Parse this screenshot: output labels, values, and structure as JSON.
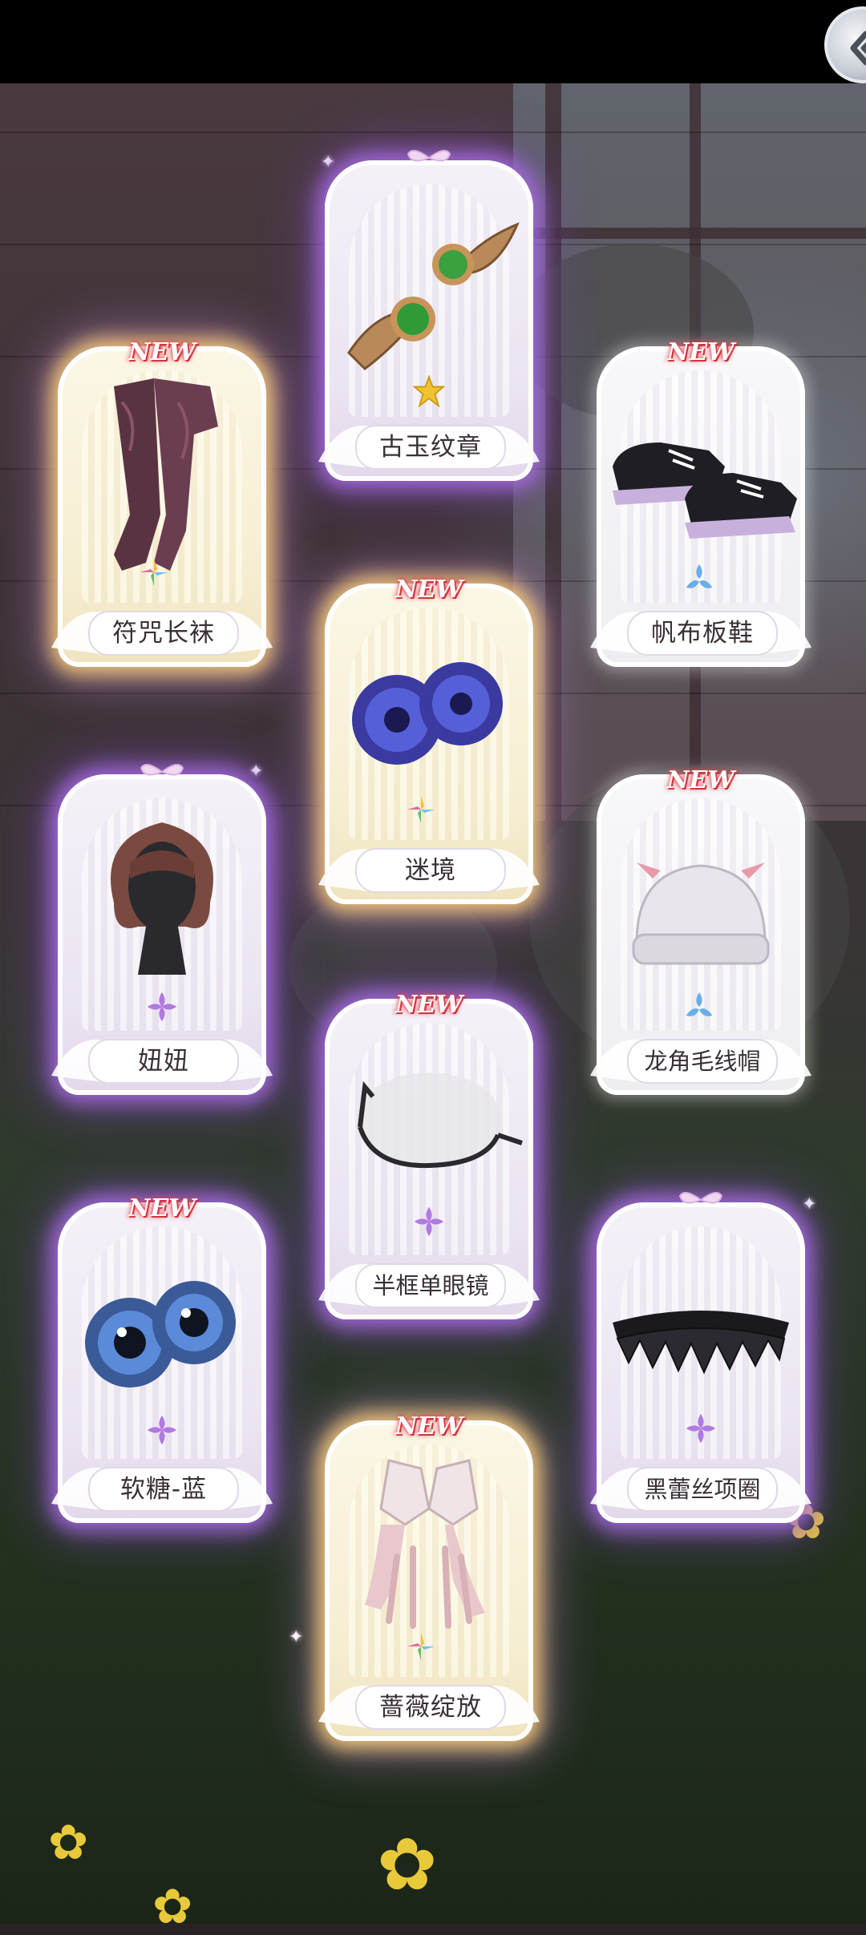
{
  "top_bar": {
    "back_icon": "back-chevron-icon"
  },
  "colors": {
    "purple_glow": "#aa6ee6",
    "gold_glow": "#facd78",
    "new_badge": "#e0404a",
    "rarity_purple": "#b07ae0",
    "rarity_blue": "#6aaee8",
    "rarity_rainbow": "#f0c040"
  },
  "cards": [
    {
      "id": "talisman-stockings",
      "label": "符咒长袜",
      "new": "NEW",
      "rarity": "rainbow",
      "frame": "gold",
      "item_icon": "stockings-icon"
    },
    {
      "id": "ancient-jade-emblem",
      "label": "古玉纹章",
      "new": "",
      "rarity": "gold",
      "frame": "purple",
      "item_icon": "jade-emblem-icon"
    },
    {
      "id": "canvas-shoes",
      "label": "帆布板鞋",
      "new": "NEW",
      "rarity": "blue",
      "frame": "white",
      "item_icon": "sneakers-icon"
    },
    {
      "id": "mystic-realm",
      "label": "迷境",
      "new": "NEW",
      "rarity": "rainbow",
      "frame": "gold",
      "item_icon": "eyes-galaxy-icon"
    },
    {
      "id": "niuniu",
      "label": "妞妞",
      "new": "",
      "rarity": "purple",
      "frame": "purple",
      "item_icon": "hairstyle-icon"
    },
    {
      "id": "dragon-horn-beanie",
      "label": "龙角毛线帽",
      "new": "NEW",
      "rarity": "blue",
      "frame": "white",
      "item_icon": "beanie-icon"
    },
    {
      "id": "half-frame-monocle",
      "label": "半框单眼镜",
      "new": "NEW",
      "rarity": "purple",
      "frame": "purple",
      "item_icon": "monocle-icon"
    },
    {
      "id": "soft-candy-blue",
      "label": "软糖-蓝",
      "new": "NEW",
      "rarity": "purple",
      "frame": "purple",
      "item_icon": "eyes-blue-icon"
    },
    {
      "id": "black-lace-choker",
      "label": "黑蕾丝项圈",
      "new": "",
      "rarity": "purple",
      "frame": "purple",
      "item_icon": "choker-icon"
    },
    {
      "id": "rose-bloom",
      "label": "蔷薇绽放",
      "new": "NEW",
      "rarity": "rainbow",
      "frame": "gold",
      "item_icon": "gloves-icon"
    }
  ]
}
